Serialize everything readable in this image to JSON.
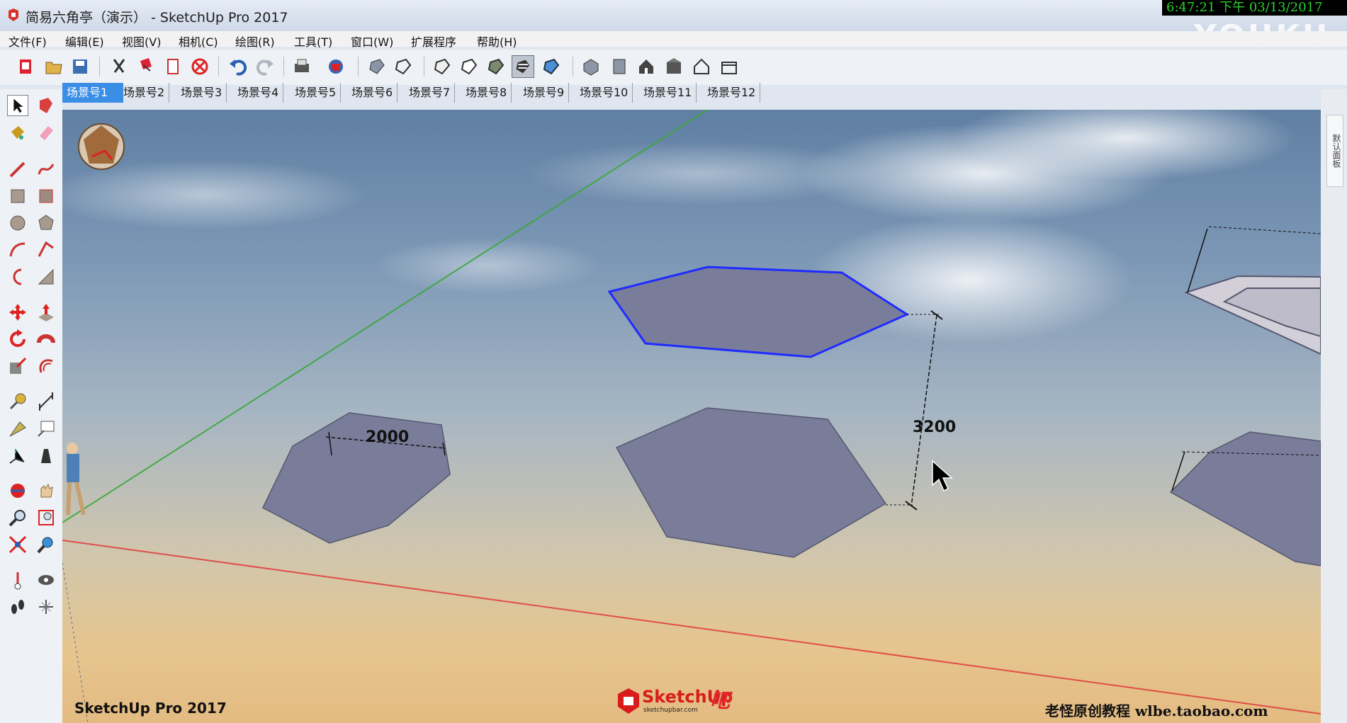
{
  "window": {
    "title": "简易六角亭（演示） - SketchUp Pro 2017",
    "clock": "6:47:21 下午 03/13/2017",
    "watermark": "YOUKU"
  },
  "menu": [
    "文件(F)",
    "编辑(E)",
    "视图(V)",
    "相机(C)",
    "绘图(R)",
    "工具(T)",
    "窗口(W)",
    "扩展程序",
    "帮助(H)"
  ],
  "scene_tabs": [
    "场景号1",
    "场景号2",
    "场景号3",
    "场景号4",
    "场景号5",
    "场景号6",
    "场景号7",
    "场景号8",
    "场景号9",
    "场景号10",
    "场景号11",
    "场景号12"
  ],
  "active_scene_index": 0,
  "right_panel": {
    "tab": "默认面板"
  },
  "viewport": {
    "dimension_radius": "2000",
    "dimension_height": "3200"
  },
  "watermarks": {
    "bottom_left": "SketchUp Pro 2017",
    "center_brand": "SketchUp",
    "center_sub": "sketchupbar.com",
    "center_suffix": "吧",
    "bottom_right": "老怪原创教程  wlbe.taobao.com"
  },
  "colors": {
    "selected_edge": "#1f2bff",
    "face": "#7a7d9a",
    "red_axis": "#e03a3a",
    "green_axis": "#3aa83a",
    "tab_active": "#3a8ee6"
  }
}
